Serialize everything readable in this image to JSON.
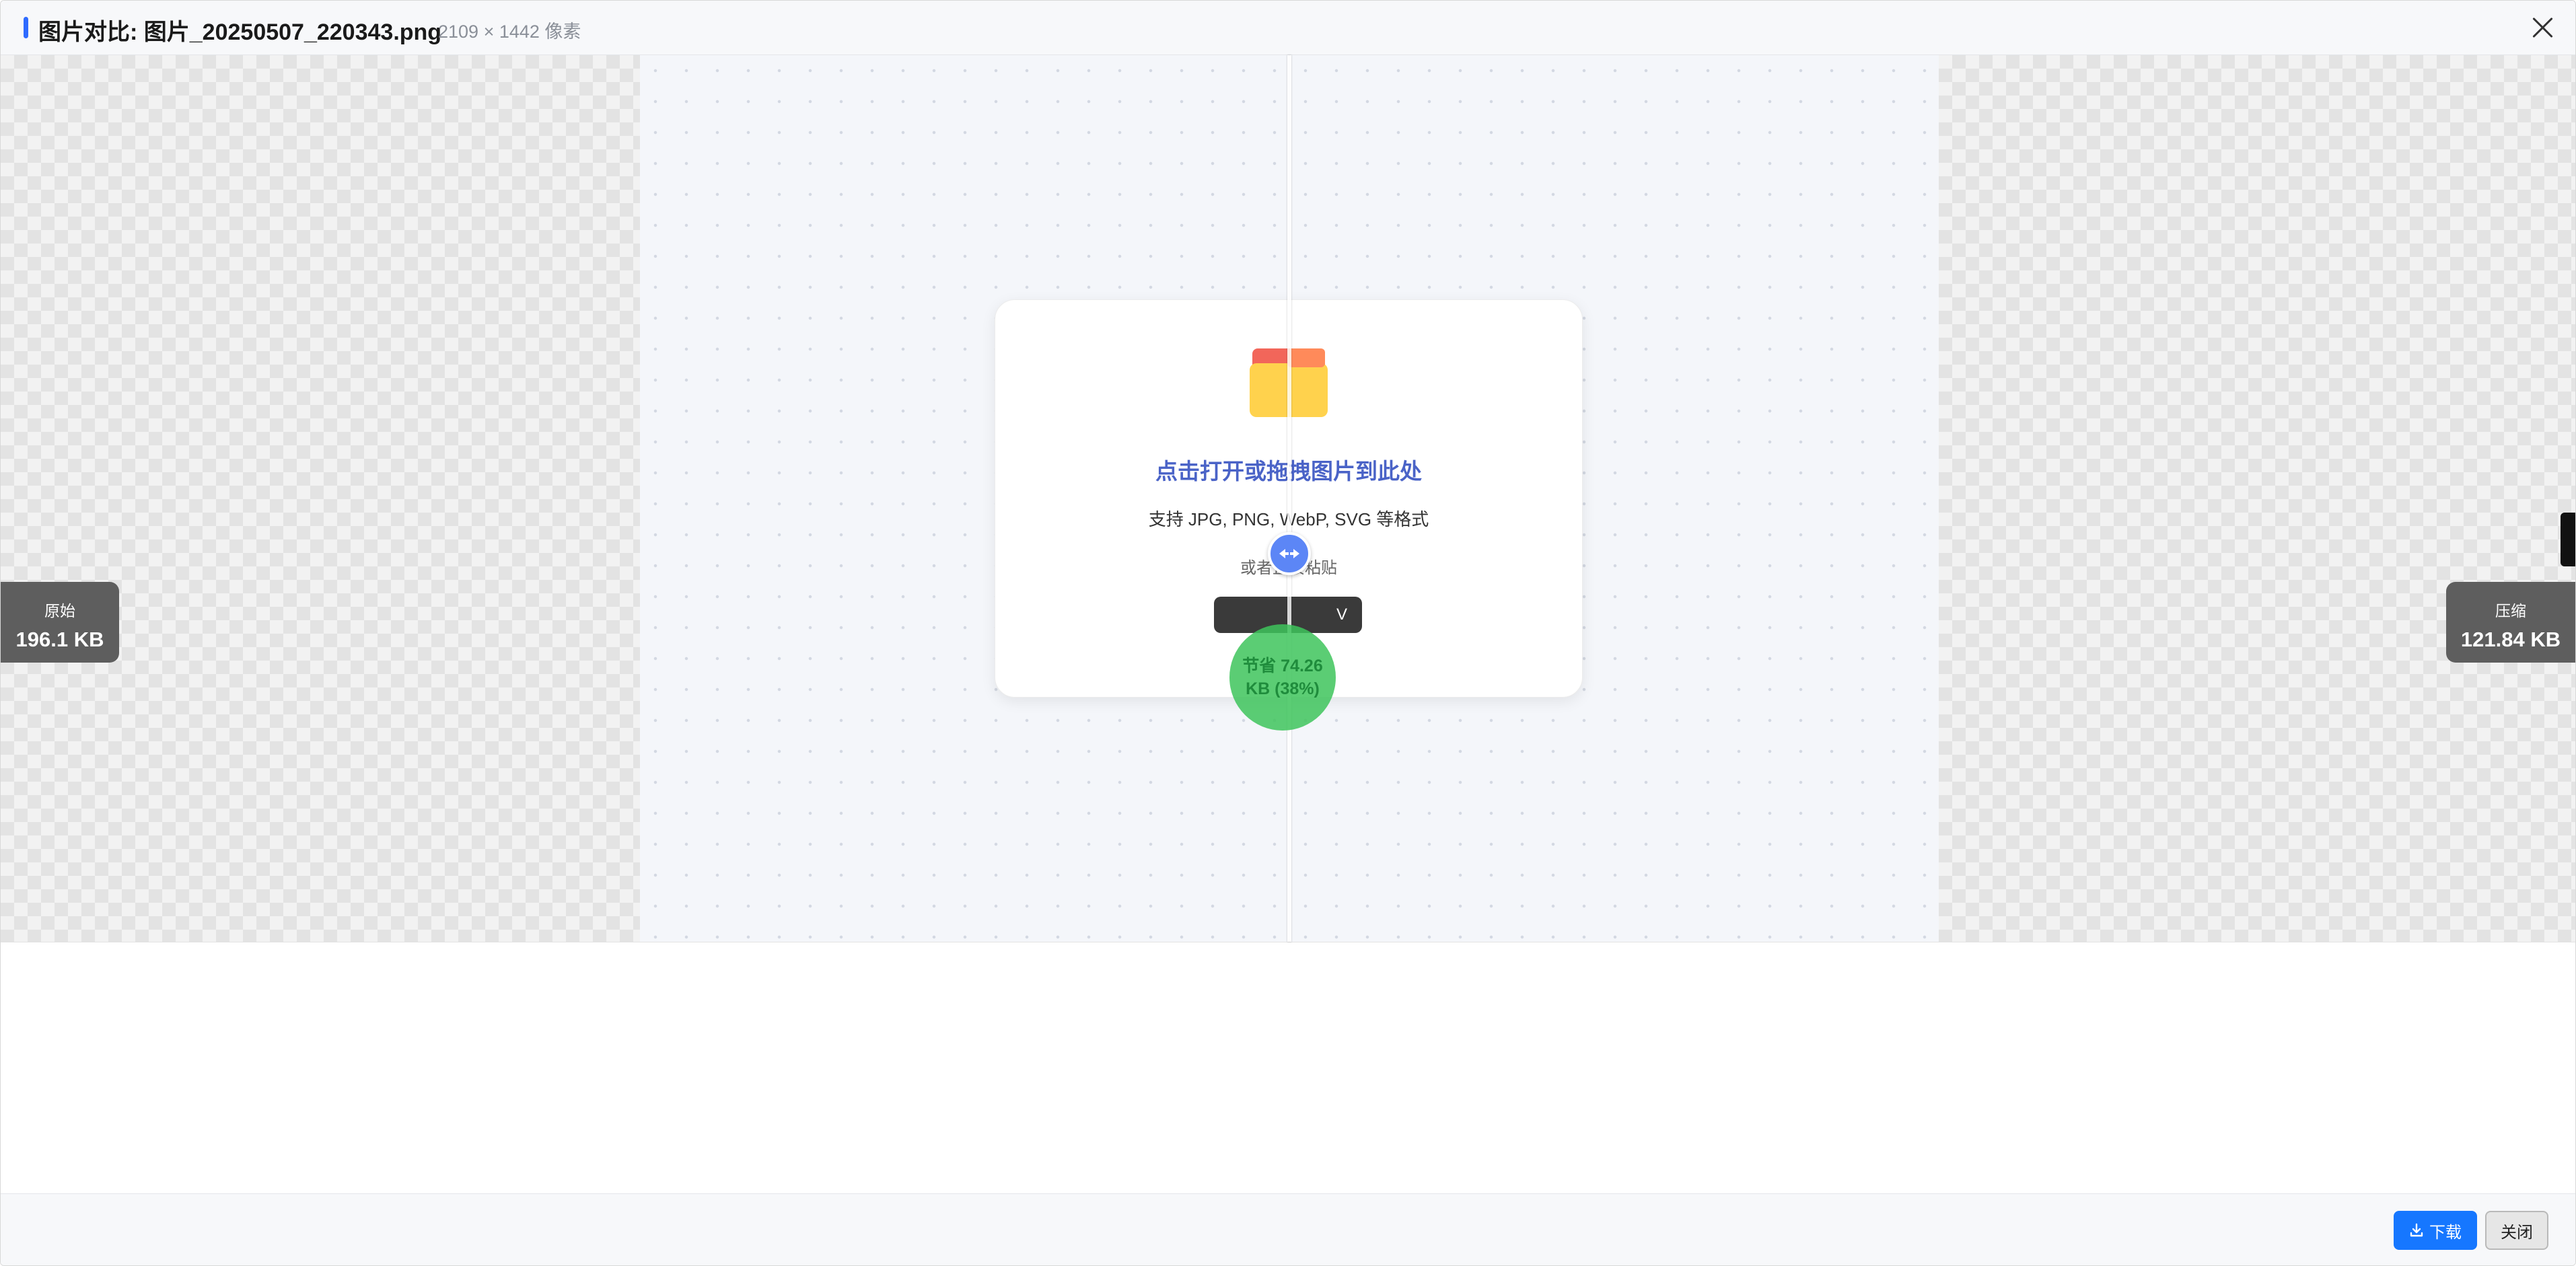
{
  "header": {
    "title": "图片对比: 图片_20250507_220343.png",
    "dimensions": "2109 × 1442 像素",
    "close_icon": "close-icon"
  },
  "comparison": {
    "original": {
      "label": "原始",
      "size": "196.1 KB"
    },
    "compressed": {
      "label": "压缩",
      "size": "121.84 KB"
    },
    "savings_line1": "节省 74.26",
    "savings_line2": "KB (38%)",
    "divider_icon": "swap-arrows-icon",
    "divider_position_percent": 50
  },
  "drop_zone": {
    "icon": "folder-icon",
    "title": "点击打开或拖拽图片到此处",
    "formats": "支持 JPG, PNG, WebP, SVG 等格式",
    "paste_hint": "或者直接粘贴",
    "paste_key": "V"
  },
  "footer": {
    "download_label": "下载",
    "close_label": "关闭"
  },
  "colors": {
    "accent": "#1677ff",
    "title_blue": "#4a63c7",
    "savings_green": "#3ec45c",
    "tag_gray": "#5e5e5e"
  }
}
